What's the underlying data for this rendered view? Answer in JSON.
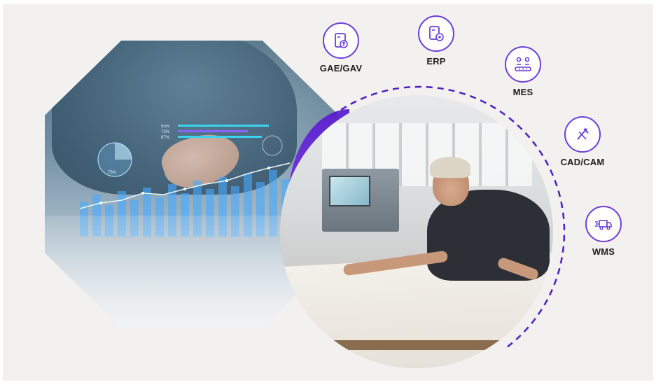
{
  "accent_color": "#6b3fd8",
  "badges": [
    {
      "label": "GAE/GAV",
      "icon": "document-upload-icon"
    },
    {
      "label": "ERP",
      "icon": "document-gear-icon"
    },
    {
      "label": "MES",
      "icon": "production-line-icon"
    },
    {
      "label": "CAD/CAM",
      "icon": "drafting-tools-icon"
    },
    {
      "label": "WMS",
      "icon": "delivery-truck-icon"
    }
  ],
  "hologram": {
    "stats": [
      "93%",
      "72%",
      "87%"
    ],
    "pie_label": "75%"
  }
}
